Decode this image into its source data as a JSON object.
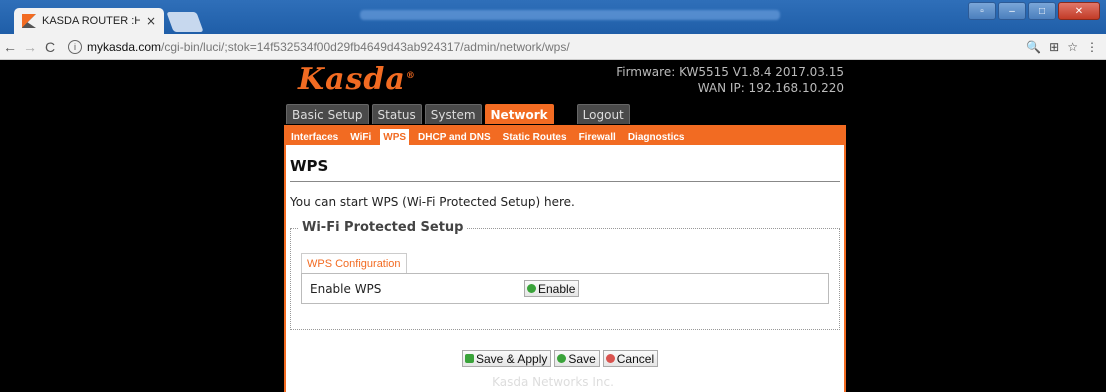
{
  "browser": {
    "tab_title": "KASDA ROUTER :Home",
    "tab_close": "×",
    "url_host": "mykasda.com",
    "url_path": "/cgi-bin/luci/;stok=14f532534f00d29fb4649d43ab924317/admin/network/wps/",
    "info_glyph": "ⓘ",
    "back": "←",
    "forward": "→",
    "reload": "C"
  },
  "header": {
    "logo": "Kasda",
    "logo_mark": "®",
    "firmware": "Firmware: KW5515 V1.8.4 2017.03.15",
    "wan_ip": "WAN IP: 192.168.10.220"
  },
  "main_menu": [
    {
      "label": "Basic Setup"
    },
    {
      "label": "Status"
    },
    {
      "label": "System"
    },
    {
      "label": "Network"
    },
    {
      "label": "Logout"
    }
  ],
  "sub_menu": [
    {
      "label": "Interfaces"
    },
    {
      "label": "WiFi"
    },
    {
      "label": "WPS"
    },
    {
      "label": "DHCP and DNS"
    },
    {
      "label": "Static Routes"
    },
    {
      "label": "Firewall"
    },
    {
      "label": "Diagnostics"
    }
  ],
  "content": {
    "title": "WPS",
    "description": "You can start WPS (Wi-Fi Protected Setup) here.",
    "section_legend": "Wi-Fi Protected Setup",
    "config_tab": "WPS Configuration",
    "enable_label": "Enable WPS",
    "enable_button": "Enable"
  },
  "actions": {
    "save_apply": "Save & Apply",
    "save": "Save",
    "cancel": "Cancel"
  },
  "footer": "Kasda Networks Inc.",
  "colors": {
    "accent": "#f26b22",
    "background": "#000000"
  }
}
